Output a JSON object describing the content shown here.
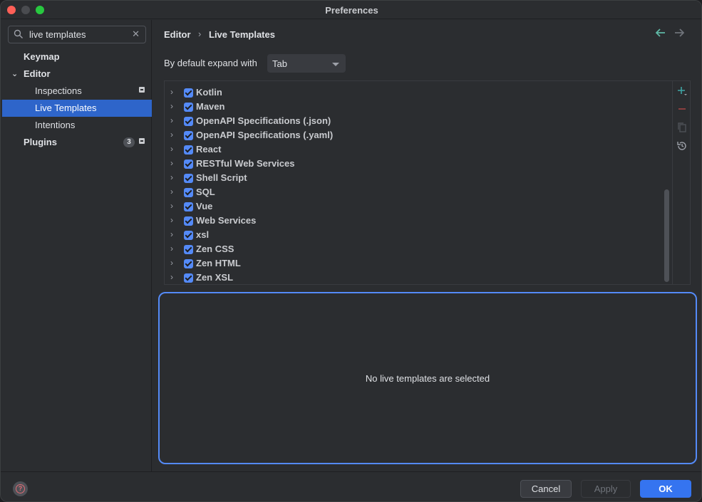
{
  "window": {
    "title": "Preferences"
  },
  "search": {
    "value": "live templates",
    "clear": "✕"
  },
  "sidebar": {
    "items": [
      {
        "label": "Keymap"
      },
      {
        "label": "Editor"
      },
      {
        "label": "Inspections"
      },
      {
        "label": "Live Templates"
      },
      {
        "label": "Intentions"
      },
      {
        "label": "Plugins",
        "count": "3"
      }
    ]
  },
  "breadcrumb": {
    "parent": "Editor",
    "separator": "›",
    "current": "Live Templates"
  },
  "settings": {
    "expand_label": "By default expand with",
    "expand_value": "Tab"
  },
  "template_groups": [
    "Kotlin",
    "Maven",
    "OpenAPI Specifications (.json)",
    "OpenAPI Specifications (.yaml)",
    "React",
    "RESTful Web Services",
    "Shell Script",
    "SQL",
    "Vue",
    "Web Services",
    "xsl",
    "Zen CSS",
    "Zen HTML",
    "Zen XSL"
  ],
  "details": {
    "message": "No live templates are selected"
  },
  "footer": {
    "help": "?",
    "cancel": "Cancel",
    "apply": "Apply",
    "ok": "OK"
  },
  "colors": {
    "accent": "#3574f0",
    "selection": "#2e65ca",
    "checkbox": "#548af7"
  }
}
